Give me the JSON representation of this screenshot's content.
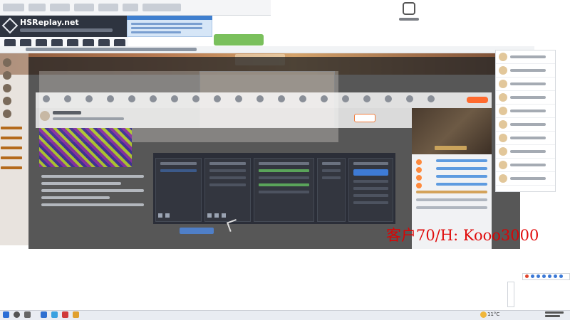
{
  "tracker": {
    "headline": "HSReplay.net",
    "weather_temp": "11°C"
  },
  "watermark": {
    "text": "客户70/H: Kooo3000"
  }
}
